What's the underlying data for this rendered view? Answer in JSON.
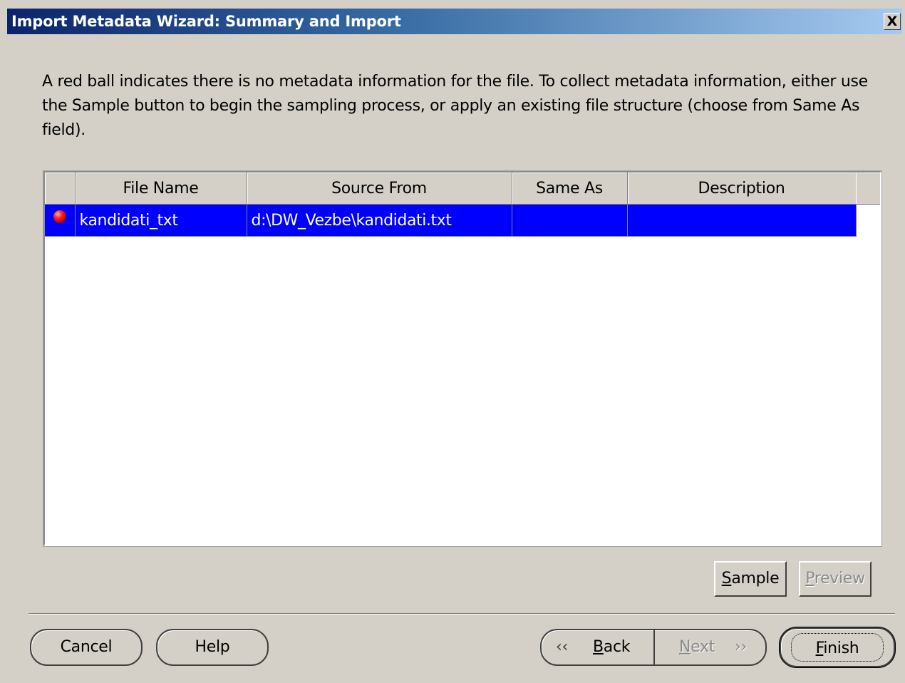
{
  "window": {
    "title": "Import Metadata Wizard: Summary and Import",
    "close_glyph": "X"
  },
  "intro_text": "A red ball indicates there is no metadata information for the file. To collect metadata information, either use the Sample button to begin the sampling process, or apply an existing file structure (choose from Same As field).",
  "table": {
    "columns": [
      "",
      "File Name",
      "Source From",
      "Same As",
      "Description"
    ],
    "rows": [
      {
        "status_icon": "red-ball-icon",
        "file_name": "kandidati_txt",
        "source_from": "d:\\DW_Vezbe\\kandidati.txt",
        "same_as": "",
        "description": ""
      }
    ]
  },
  "buttons": {
    "sample": {
      "first": "S",
      "rest": "ample"
    },
    "preview": {
      "first": "P",
      "rest": "review"
    },
    "cancel": "Cancel",
    "help": "Help",
    "back": {
      "first": "B",
      "rest": "ack"
    },
    "next": {
      "first": "N",
      "rest": "ext"
    },
    "finish": {
      "first": "F",
      "rest": "inish"
    }
  },
  "colors": {
    "selection": "#0000ff",
    "title_gradient_start": "#0a246a",
    "title_gradient_end": "#a6caf0",
    "dialog_bg": "#d4d0c8"
  }
}
